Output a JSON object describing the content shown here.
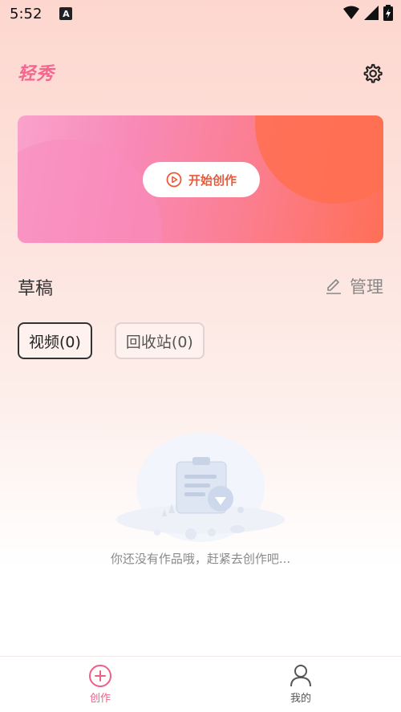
{
  "status_bar": {
    "time": "5:52",
    "notification_letter": "A"
  },
  "header": {
    "logo": "轻秀",
    "settings_icon": "gear-icon"
  },
  "banner": {
    "button_label": "开始创作",
    "button_icon": "play-circle-icon"
  },
  "drafts": {
    "title": "草稿",
    "manage_label": "管理",
    "manage_icon": "edit-pencil-icon"
  },
  "tabs": [
    {
      "label": "视频(0)",
      "active": true
    },
    {
      "label": "回收站(0)",
      "active": false
    }
  ],
  "empty_state": {
    "message": "你还没有作品哦，赶紧去创作吧..."
  },
  "bottom_nav": {
    "items": [
      {
        "label": "创作",
        "icon": "plus-circle-icon",
        "active": true
      },
      {
        "label": "我的",
        "icon": "user-icon",
        "active": false
      }
    ]
  },
  "colors": {
    "accent": "#ef5e85",
    "start_text": "#ea5a3a",
    "logo": "#f46590"
  }
}
